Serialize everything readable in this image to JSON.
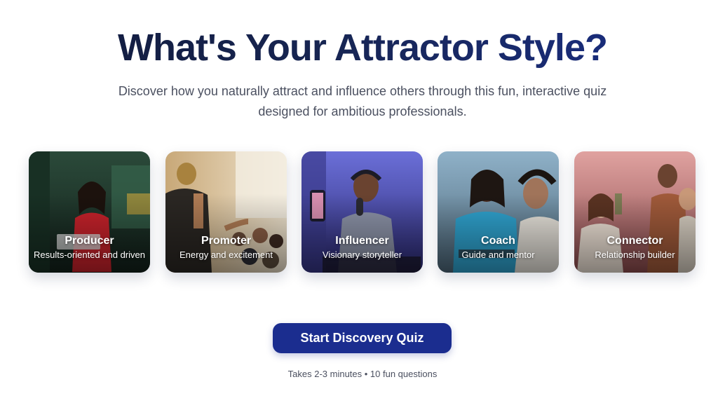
{
  "hero": {
    "title": "What's Your Attractor Style?",
    "subtitle": "Discover how you naturally attract and influence others through this fun, interactive quiz designed for ambitious professionals."
  },
  "styles": [
    {
      "name": "Producer",
      "description": "Results-oriented and driven",
      "tint": "#2f6f4e"
    },
    {
      "name": "Promoter",
      "description": "Energy and excitement",
      "tint": "#8a6a3c"
    },
    {
      "name": "Influencer",
      "description": "Visionary storyteller",
      "tint": "#3d3a9a"
    },
    {
      "name": "Coach",
      "description": "Guide and mentor",
      "tint": "#5a7f99"
    },
    {
      "name": "Connector",
      "description": "Relationship builder",
      "tint": "#b55a5e"
    }
  ],
  "cta": {
    "label": "Start Discovery Quiz",
    "note": "Takes 2-3 minutes • 10 fun questions"
  },
  "colors": {
    "title_gradient_start": "#111a3a",
    "title_gradient_end": "#1a2f8a",
    "cta_background": "#1b2d8f"
  }
}
